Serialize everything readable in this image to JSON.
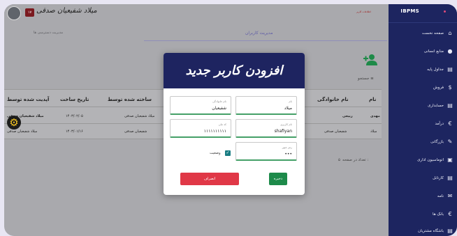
{
  "sidebar": {
    "brand": "IBPMS",
    "items": [
      {
        "label": "صفحه نخست",
        "icon": "home-icon"
      },
      {
        "label": "منابع انسانی",
        "icon": "person-icon"
      },
      {
        "label": "جداول پایه",
        "icon": "document-icon"
      },
      {
        "label": "فروش",
        "icon": "dollar-icon"
      },
      {
        "label": "حسابداری",
        "icon": "document-icon"
      },
      {
        "label": "درآمد",
        "icon": "euro-icon"
      },
      {
        "label": "بازرگانی",
        "icon": "wrench-icon"
      },
      {
        "label": "اتوماسیون اداری",
        "icon": "lock-icon"
      },
      {
        "label": "کارتابل",
        "icon": "document-icon"
      },
      {
        "label": "نامه",
        "icon": "mail-icon"
      },
      {
        "label": "بانک ها",
        "icon": "euro-icon"
      },
      {
        "label": "باشگاه مشتریان",
        "icon": "document-icon"
      }
    ]
  },
  "topbar": {
    "user_name": "میلاد شفیعیان صدقی",
    "badge": "۱۷",
    "red_text": "اطلاعات كاربر"
  },
  "subbar": {
    "left_text": "مدیریت دسترسی ها",
    "title": "مدیریت کاربران"
  },
  "toolbar": {
    "filter_label": "جستجو"
  },
  "table": {
    "headers": [
      "نام",
      "نام خانوادگی",
      "ساخته شده توسط",
      "تاریخ ساخت",
      "آپدیت شده توسط"
    ],
    "rows": [
      [
        "مهدی",
        "ربیعی",
        "میلاد شفیعیان صدقی",
        "۱۴۰۳/۰۲/۰۵",
        "میلاد شفیعیان صدقی"
      ],
      [
        "میلاد",
        "شفیعیان صدقی",
        "شفیعیان صدقی",
        "۱۴۰۳/۰۱/۱۶",
        "میلاد شفیعیان صدقی"
      ]
    ],
    "pager_text": "تعداد در صفحه :",
    "pager_value": "۵"
  },
  "modal": {
    "title": "افزودن کاربر جدید",
    "fields": {
      "first_name": {
        "label": "نام",
        "value": "میلاد"
      },
      "last_name": {
        "label": "نام خانوادگی",
        "value": "شفیعیان"
      },
      "username": {
        "label": "نام کاربری",
        "value": "shafiyan"
      },
      "national_code": {
        "label": "کد ملی",
        "value": "۱۱۱۱۱۱۱۱۱۱"
      },
      "password": {
        "label": "رمز عبور",
        "value": "•••"
      }
    },
    "active_label": "وضعیت",
    "save_label": "ذخیره",
    "cancel_label": "انصراف"
  },
  "colors": {
    "sidebar": "#1d2560",
    "accent_green": "#1d8a4a",
    "cancel_red": "#e03847",
    "gear_yellow": "#f3c322"
  }
}
